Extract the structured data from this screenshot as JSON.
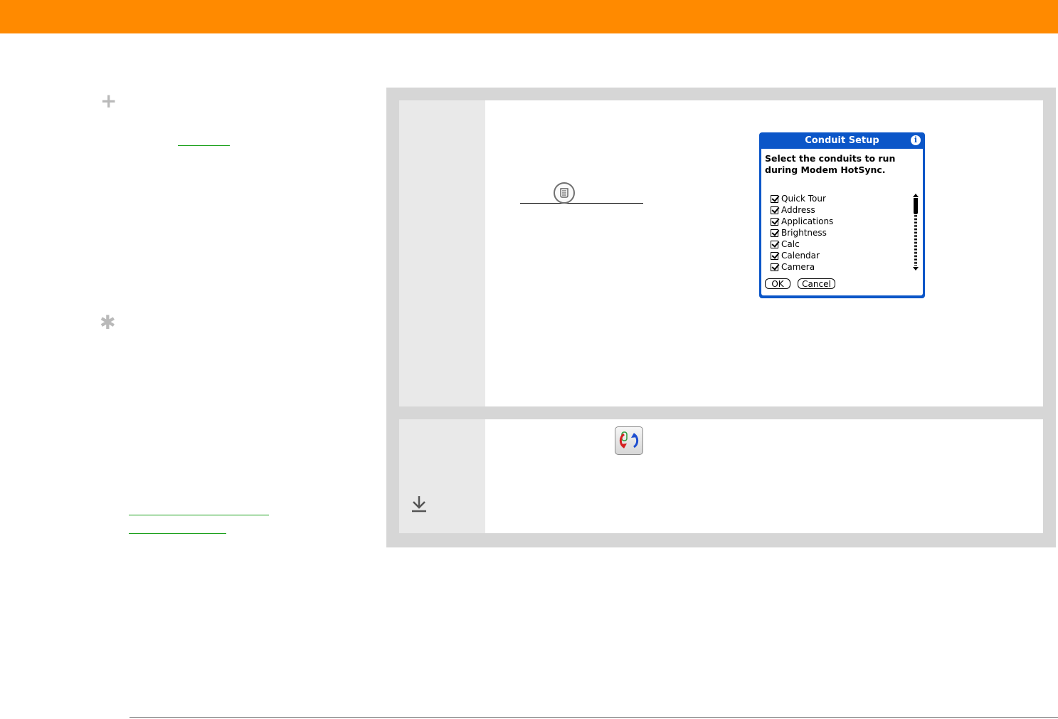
{
  "colors": {
    "header": "#ff8a00",
    "panel": "#d6d6d6",
    "dialog_blue": "#0b56c8",
    "link_green": "#1aa01a"
  },
  "sidebar": {
    "tip_icon": "plus-icon",
    "note_icon": "asterisk-icon",
    "tip_symbol": "+",
    "note_symbol": "✱"
  },
  "dialog": {
    "title": "Conduit Setup",
    "prompt": "Select the conduits to run during Modem HotSync.",
    "conduits": [
      "Quick Tour",
      "Address",
      "Applications",
      "Brightness",
      "Calc",
      "Calendar",
      "Camera"
    ],
    "ok_label": "OK",
    "cancel_label": "Cancel",
    "info_symbol": "i"
  },
  "icons": {
    "menu": "menu-icon",
    "hotsync": "hotsync-icon",
    "download": "download-arrow-icon",
    "info": "info-icon"
  }
}
